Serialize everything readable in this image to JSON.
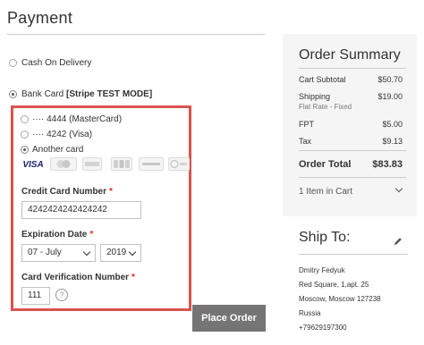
{
  "payment": {
    "title": "Payment",
    "options": {
      "cod": {
        "label": "Cash On Delivery",
        "selected": false
      },
      "bank": {
        "label_prefix": "Bank Card ",
        "label_bold": "[Stripe TEST MODE]",
        "selected": true
      }
    }
  },
  "bank_card": {
    "saved_cards": [
      {
        "label": "···· 4444 (MasterCard)",
        "selected": false
      },
      {
        "label": "···· 4242 (Visa)",
        "selected": false
      },
      {
        "label": "Another card",
        "selected": true
      }
    ],
    "card_brands": [
      "VISA",
      "MasterCard",
      "American Express",
      "JCB",
      "DISCOVER",
      "Diners Club"
    ],
    "credit_card_number": {
      "label": "Credit Card Number",
      "required": "*",
      "value": "4242424242424242"
    },
    "expiration_date": {
      "label": "Expiration Date",
      "required": "*",
      "month": "07 - July",
      "year": "2019"
    },
    "cvv": {
      "label": "Card Verification Number",
      "required": "*",
      "value": "111",
      "help": "?"
    }
  },
  "actions": {
    "place_order": "Place Order"
  },
  "order_summary": {
    "title": "Order Summary",
    "rows": [
      {
        "label": "Cart Subtotal",
        "value": "$50.70"
      },
      {
        "label": "Shipping",
        "value": "$19.00",
        "sub": "Flat Rate - Fixed"
      },
      {
        "label": "FPT",
        "value": "$5.00"
      },
      {
        "label": "Tax",
        "value": "$9.13"
      }
    ],
    "total": {
      "label": "Order Total",
      "value": "$83.83"
    },
    "items_in_cart": "1 Item in Cart"
  },
  "ship_to": {
    "title": "Ship To:",
    "address": [
      "Dmitry Fedyuk",
      "Red Square, 1,apt. 25",
      "Moscow, Moscow 127238",
      "Russia",
      "+79629197300"
    ]
  },
  "colors": {
    "highlight_border": "#d9534f",
    "button_bg": "#757575",
    "required": "#e02b27",
    "summary_bg": "#f5f5f5"
  }
}
